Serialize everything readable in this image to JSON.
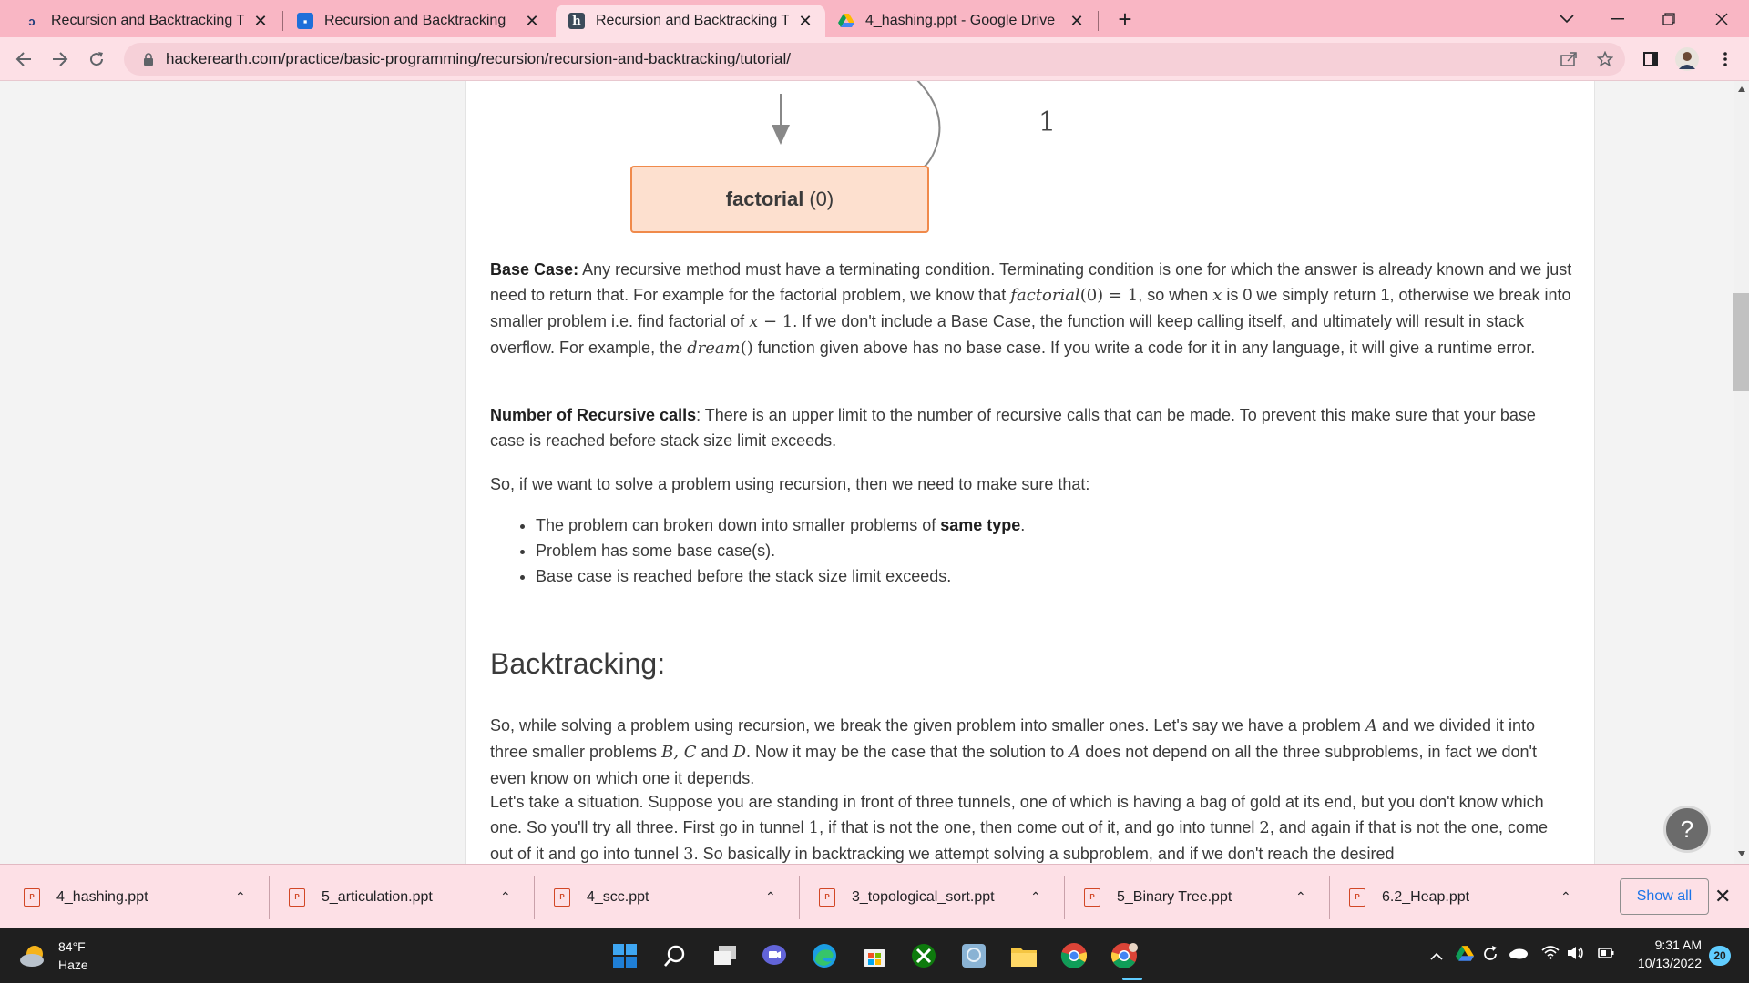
{
  "tabs": [
    {
      "title": "Recursion and Backtracking Tuto",
      "icon": "hackerearth-icon",
      "close": "✕"
    },
    {
      "title": "Recursion and Backtracking",
      "icon": "classroom-icon",
      "close": "✕"
    },
    {
      "title": "Recursion and Backtracking Tuto",
      "icon": "hackerearth-h-icon",
      "close": "✕",
      "active": true
    },
    {
      "title": "4_hashing.ppt - Google Drive",
      "icon": "google-drive-icon",
      "close": "✕"
    }
  ],
  "new_tab": "+",
  "address": {
    "url": "hackerearth.com/practice/basic-programming/recursion/recursion-and-backtracking/tutorial/"
  },
  "diagram": {
    "func": "factorial",
    "arg": "(0)",
    "return_value": "1"
  },
  "content": {
    "base_case_label": "Base Case:",
    "base_case_p1": " Any recursive method must have a terminating condition. Terminating condition is one for which the answer is already known and we just need to return that. For example for the factorial problem, we know that ",
    "base_case_m1": "factorial",
    "base_case_m1b": "(0) = 1",
    "base_case_p2": ", so when ",
    "base_case_mx": "x",
    "base_case_p3": " is 0 we simply return 1, otherwise we break into smaller problem i.e. find factorial of ",
    "base_case_m2": "x",
    "base_case_m2b": " − 1",
    "base_case_p4": ". If we don't include a Base Case, the function will keep calling itself, and ultimately will result in stack overflow. For example, the ",
    "base_case_m3": "dream",
    "base_case_m3b": "()",
    "base_case_p5": " function given above has no base case. If you write a code for it in any language, it will give a runtime error.",
    "recursive_calls_label": "Number of Recursive calls",
    "recursive_calls_text": ": There is an upper limit to the number of recursive calls that can be made. To prevent this make sure that your base case is reached before stack size limit exceeds.",
    "intro_list": "So, if we want to solve a problem using recursion, then we need to make sure that:",
    "bullet1_text": "The problem can broken down into smaller problems of ",
    "bullet1_bold": "same type",
    "bullet1_end": ".",
    "bullet2": "Problem has some base case(s).",
    "bullet3": "Base case is reached before the stack size limit exceeds.",
    "backtracking_heading": "Backtracking:",
    "bt_p1a": "So, while solving a problem using recursion, we break the given problem into smaller ones. Let's say we have a problem ",
    "bt_A": "A",
    "bt_p1b": " and we divided it into three smaller problems ",
    "bt_BC": "B, C",
    "bt_and": " and ",
    "bt_D": "D",
    "bt_p1c": ". Now it may be the case that the solution to ",
    "bt_A2": "A",
    "bt_p1d": " does not depend on all the three subproblems, in fact we don't even know on which one it depends.",
    "bt_p2a": "Let's take a situation. Suppose you are standing in front of three tunnels, one of which is having a bag of gold at its end, but you don't know which one. So you'll try all three. First go in tunnel ",
    "bt_one": "1",
    "bt_p2b": ", if that is not the one, then come out of it, and go into tunnel ",
    "bt_two": "2",
    "bt_p2c": ", and again if that is not the one, come out of it and go into tunnel ",
    "bt_three": "3",
    "bt_p2d": ". So basically in backtracking we attempt solving a subproblem, and if we don't reach the desired"
  },
  "help_button": "?",
  "downloads": [
    "4_hashing.ppt",
    "5_articulation.ppt",
    "4_scc.ppt",
    "3_topological_sort.ppt",
    "5_Binary Tree.ppt",
    "6.2_Heap.ppt"
  ],
  "show_all": "Show all",
  "taskbar": {
    "weather_temp": "84°F",
    "weather_desc": "Haze",
    "time": "9:31 AM",
    "date": "10/13/2022",
    "notifications": "20"
  }
}
